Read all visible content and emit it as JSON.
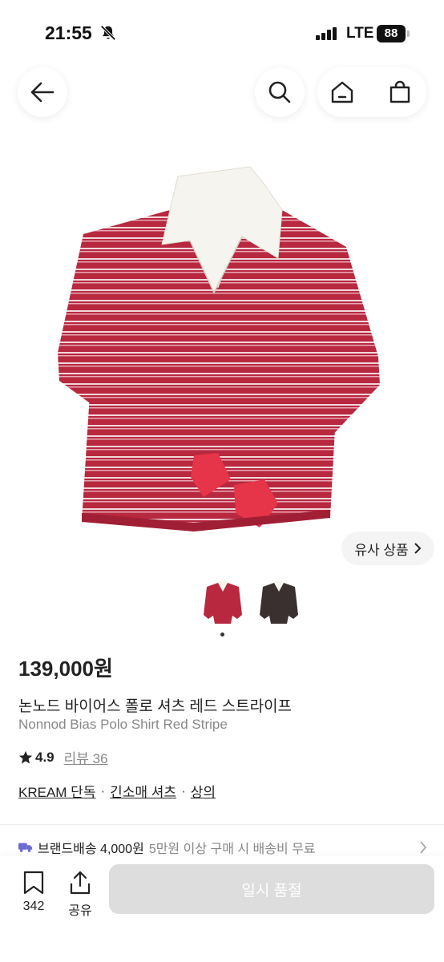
{
  "status_bar": {
    "time": "21:55",
    "network": "LTE",
    "battery": "88"
  },
  "similar_button": {
    "label": "유사 상품"
  },
  "product": {
    "price": "139,000원",
    "name_ko": "논노드 바이어스 폴로 셔츠 레드 스트라이프",
    "name_en": "Nonnod Bias Polo Shirt Red Stripe",
    "rating": "4.9",
    "review_label": "리뷰 36",
    "tags": [
      "KREAM 단독",
      "긴소매 셔츠",
      "상의"
    ],
    "tag_separator": "·"
  },
  "shipping": {
    "label": "브랜드배송 4,000원",
    "note": "5만원 이상 구매 시 배송비 무료"
  },
  "bottom_bar": {
    "save_count": "342",
    "share_label": "공유",
    "cta_label": "일시 품절"
  },
  "colors": {
    "shirt_red": "#b8283f",
    "stripe": "#f1d7dc",
    "collar": "#f6f4ee",
    "cuff": "#e63448",
    "cta_disabled": "#dddddd",
    "muted_text": "#888888"
  },
  "icons": [
    "bell-slash-icon",
    "signal-icon",
    "back-arrow-icon",
    "search-icon",
    "home-icon",
    "cart-icon",
    "chevron-right-icon",
    "star-icon",
    "truck-icon",
    "bookmark-icon",
    "share-icon"
  ]
}
